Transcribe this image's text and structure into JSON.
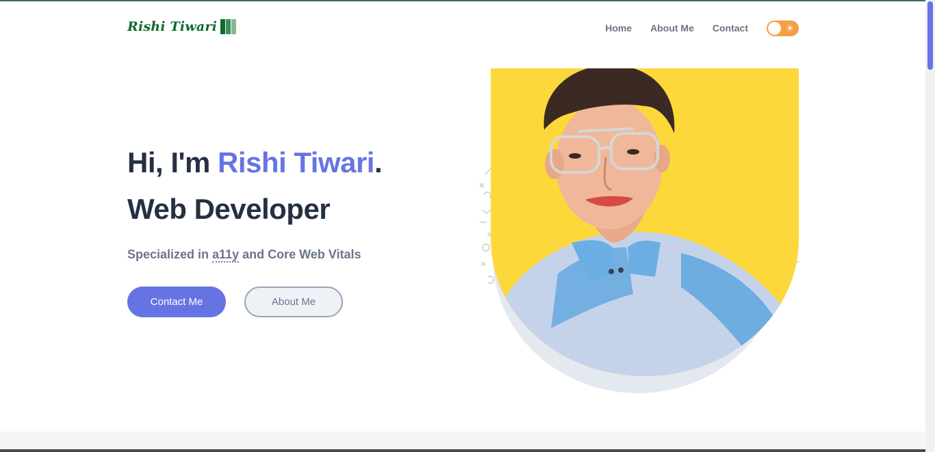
{
  "header": {
    "logo_text": "Rishi Tiwari",
    "logo_bar_colors": [
      "#0f6b2e",
      "#3f8f5a",
      "#86b796"
    ],
    "nav": [
      {
        "label": "Home"
      },
      {
        "label": "About Me"
      },
      {
        "label": "Contact"
      }
    ],
    "theme_toggle_icon": "sun-icon"
  },
  "hero": {
    "greeting": "Hi, I'm ",
    "name": "Rishi Tiwari",
    "punct": ".",
    "role": "Web Developer",
    "spec_prefix": "Specialized in ",
    "spec_abbr": "a11y",
    "spec_suffix": " and Core Web Vitals",
    "primary_button": "Contact Me",
    "secondary_button": "About Me"
  },
  "colors": {
    "accent": "#6674e3",
    "heading": "#263043",
    "muted": "#6b7589",
    "toggle": "#f59e45",
    "photo_bg": "#fdd83a"
  }
}
